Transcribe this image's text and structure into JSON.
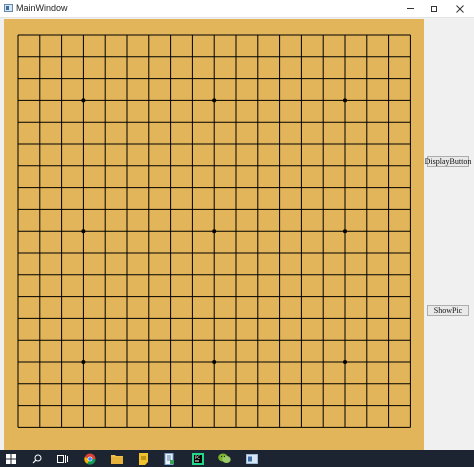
{
  "window": {
    "title": "MainWindow",
    "controls": {
      "minimize": "minimize-icon",
      "maximize": "maximize-icon",
      "close": "close-icon"
    }
  },
  "board": {
    "grid_lines": 19,
    "star_points": [
      [
        3,
        3
      ],
      [
        9,
        3
      ],
      [
        15,
        3
      ],
      [
        3,
        9
      ],
      [
        9,
        9
      ],
      [
        15,
        9
      ],
      [
        3,
        15
      ],
      [
        9,
        15
      ],
      [
        15,
        15
      ]
    ],
    "colors": {
      "board": "#e2b55a",
      "line": "#000000"
    }
  },
  "buttons": {
    "display_label": "DisplayButton",
    "showpic_label": "ShowPic"
  },
  "taskbar": {
    "items": [
      "windows-start-icon",
      "search-icon",
      "task-view-icon",
      "chrome-icon",
      "file-explorer-icon",
      "sticky-app-icon",
      "notepad-icon",
      "pycharm-icon",
      "wechat-icon",
      "qt-window-icon"
    ]
  }
}
